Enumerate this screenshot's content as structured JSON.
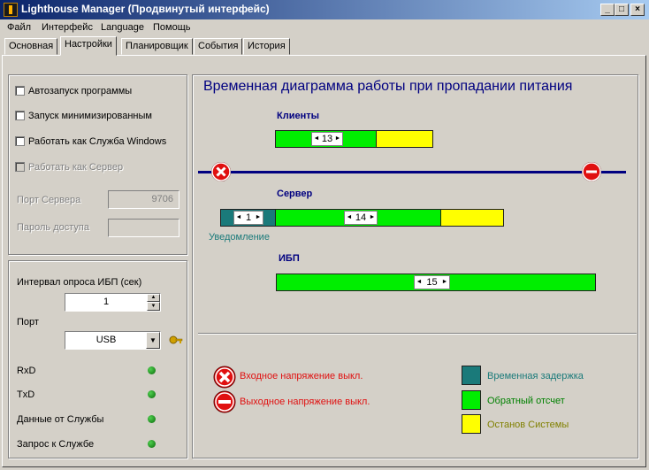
{
  "window": {
    "title": "Lighthouse Manager (Продвинутый интерфейс)",
    "buttons": {
      "minimize": "_",
      "maximize": "□",
      "close": "×"
    }
  },
  "menu": [
    "Файл",
    "Интерфейс",
    "Language",
    "Помощь"
  ],
  "tabs": [
    "Основная",
    "Настройки",
    "Планировщик",
    "События",
    "История"
  ],
  "active_tab": "Настройки",
  "settings": {
    "autostart": "Автозапуск программы",
    "start_minimized": "Запуск минимизированным",
    "run_as_service": "Работать как Служба Windows",
    "run_as_server": "Работать как Сервер",
    "server_port_label": "Порт Сервера",
    "server_port_value": "9706",
    "password_label": "Пароль доступа",
    "password_value": ""
  },
  "ups": {
    "poll_interval_label": "Интервал опроса ИБП (сек)",
    "poll_interval_value": "1",
    "port_label": "Порт",
    "port_value": "USB",
    "indicators": [
      "RxD",
      "TxD",
      "Данные от Службы",
      "Запрос к Службе"
    ]
  },
  "diagram": {
    "title": "Временная диаграмма работы при пропадании питания",
    "clients": {
      "label": "Клиенты",
      "countdown": "13"
    },
    "server": {
      "label": "Сервер",
      "delay": "1",
      "countdown": "14",
      "notice": "Уведомление"
    },
    "ups": {
      "label": "ИБП",
      "countdown": "15"
    }
  },
  "legend": {
    "input_off": "Входное напряжение выкл.",
    "output_off": "Выходное напряжение выкл.",
    "delay": "Временная задержка",
    "countdown": "Обратный отсчет",
    "shutdown": "Останов Системы"
  },
  "colors": {
    "title_grad_start": "#0a246a",
    "title_grad_end": "#a6caf0",
    "countdown": "#00ee00",
    "shutdown": "#ffff00",
    "delay": "#1a7a7a",
    "alarm": "#e01010",
    "timeline": "#000080"
  },
  "icons": {
    "app": "lighthouse-icon",
    "connect": "key-icon"
  }
}
